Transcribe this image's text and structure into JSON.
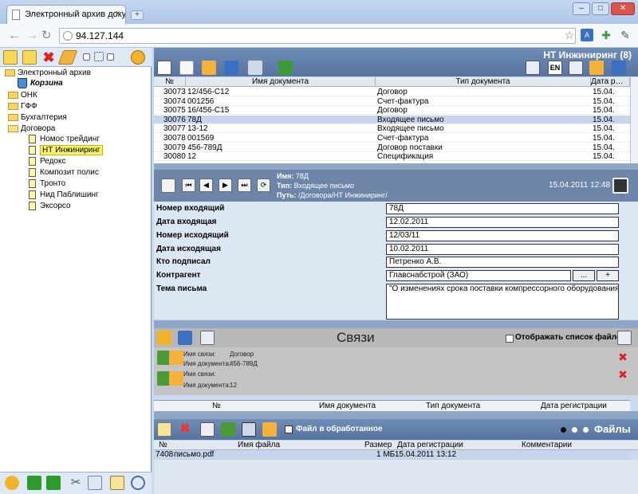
{
  "browser": {
    "tab_title": "Электронный архив доку…",
    "tab_close": "×",
    "new_tab": "+",
    "url": "94.127.144",
    "win_min": "–",
    "win_max": "□",
    "win_close": "✕"
  },
  "tree": {
    "root": "Электронный архив",
    "trash": "Корзина",
    "folders": [
      "ОНК",
      "ГФФ",
      "Бухгалтерия",
      "Договора"
    ],
    "subitems": [
      "Номос трейдинг",
      "НТ Инжиниринг",
      "Редокс",
      "Композит полис",
      "Тронто",
      "Нид Паблишинг",
      "Эксорсо"
    ]
  },
  "docs": {
    "title": "НТ Инжиниринг (8)",
    "lang_label": "EN",
    "columns": [
      "№",
      "Имя документа",
      "Тип документа",
      "Дата р…"
    ],
    "rows": [
      {
        "num": "30073",
        "name": "12/456-С12",
        "type": "Договор",
        "date": "15.04."
      },
      {
        "num": "30074",
        "name": "001256",
        "type": "Счет-фактура",
        "date": "15.04."
      },
      {
        "num": "30075",
        "name": "16/456-С15",
        "type": "Договор",
        "date": "15.04."
      },
      {
        "num": "30076",
        "name": "78Д",
        "type": "Входящее письмо",
        "date": "15.04."
      },
      {
        "num": "30077",
        "name": "13-12",
        "type": "Входящее письмо",
        "date": "15.04."
      },
      {
        "num": "30078",
        "name": "001569",
        "type": "Счет-фактура",
        "date": "15.04."
      },
      {
        "num": "30079",
        "name": "456-789Д",
        "type": "Договор поставки",
        "date": "15.04."
      },
      {
        "num": "30080",
        "name": "12",
        "type": "Спецификация",
        "date": "15.04."
      }
    ]
  },
  "card": {
    "name_label": "Имя:",
    "name_value": "78Д",
    "type_label": "Тип:",
    "type_value": "Входящее письмо",
    "path_label": "Путь:",
    "path_value": "/Договора/НТ Инжиниринг/",
    "datetime": "15.04.2011 12:48",
    "fields": [
      {
        "label": "Номер входящий",
        "value": "78Д"
      },
      {
        "label": "Дата входящая",
        "value": "12.02.2011"
      },
      {
        "label": "Номер исходящий",
        "value": "12/03/11"
      },
      {
        "label": "Дата исходящая",
        "value": "10.02.2011"
      },
      {
        "label": "Кто подписал",
        "value": "Петренко А.В."
      },
      {
        "label": "Контрагент",
        "value": "Главснабстрой (ЗАО)"
      },
      {
        "label": "Тема письма",
        "value": "\"О изменениях срока поставки компрессорного оборудования\""
      }
    ],
    "contr_more": "...",
    "contr_add": "+"
  },
  "links": {
    "title": "Связи",
    "show_files": "Отображать список файлов",
    "link1_name_label": "Имя связи:",
    "link1_name": "Договор",
    "link1_doc_label": "Имя документа:",
    "link1_doc": "456-789Д",
    "link2_name_label": "Имя связи:",
    "link2_name": "",
    "link2_doc_label": "Имя документа:",
    "link2_doc": "12",
    "columns": [
      "№",
      "Имя документа",
      "Тип документа",
      "Дата регистрации"
    ]
  },
  "files": {
    "processed_label": "Файл в обработанное",
    "title": "Файлы",
    "columns": [
      "№",
      "Имя файла",
      "Размер",
      "Дата регистрации",
      "Комментарии"
    ],
    "row": {
      "num": "7408",
      "name": "письмо.pdf",
      "size": "1 МБ",
      "date": "15.04.2011 13:12",
      "comment": ""
    }
  }
}
